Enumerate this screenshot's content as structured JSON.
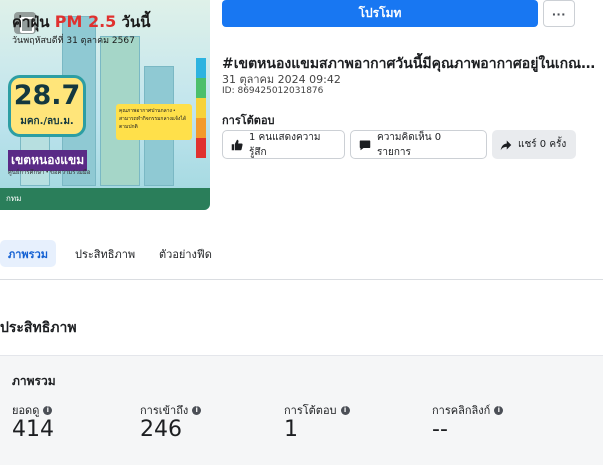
{
  "thumbnail": {
    "headline_prefix": "ค่าฝุ่น",
    "headline_pm": "PM 2.5",
    "headline_suffix": "วันนี้",
    "date_line": "วันพฤหัสบดีที่ 31 ตุลาคม 2567",
    "aqi_value": "28.7",
    "aqi_unit": "มคก./ลบ.ม.",
    "district": "เขตหนองแขม",
    "district_sub": "ศูนย์การศึกษา • ขอความร่วมมือ",
    "note": "คุณภาพอากาศปานกลาง • สามารถทำกิจกรรมกลางแจ้งได้ตามปกติ",
    "footer_logo": "กทม",
    "scale_colors": [
      "#2db3e0",
      "#4cbf6a",
      "#f7d23a",
      "#f39a2b",
      "#e0312f"
    ]
  },
  "header": {
    "promote_label": "โปรโมท",
    "more_label": "···"
  },
  "post": {
    "title": "#เขตหนองแขมสภาพอากาศวันนี้มีคุณภาพอากาศอยู่ในเกณฑ์ปานกลาง",
    "date": "31 ตุลาคม 2024 09:42",
    "id": "ID: 869425012031876"
  },
  "reactions": {
    "heading": "การโต้ตอบ",
    "likes_label": "1 คนแสดงความรู้สึก",
    "comments_label": "ความคิดเห็น 0 รายการ",
    "shares_label": "แชร์ 0 ครั้ง"
  },
  "tabs": [
    {
      "label": "ภาพรวม",
      "active": true
    },
    {
      "label": "ประสิทธิภาพ",
      "active": false
    },
    {
      "label": "ตัวอย่างฟีด",
      "active": false
    }
  ],
  "performance": {
    "section_title": "ประสิทธิภาพ",
    "card_title": "ภาพรวม",
    "metrics": [
      {
        "label": "ยอดดู",
        "value": "414"
      },
      {
        "label": "การเข้าถึง",
        "value": "246"
      },
      {
        "label": "การโต้ตอบ",
        "value": "1"
      },
      {
        "label": "การคลิกลิงก์",
        "value": "--"
      }
    ]
  }
}
